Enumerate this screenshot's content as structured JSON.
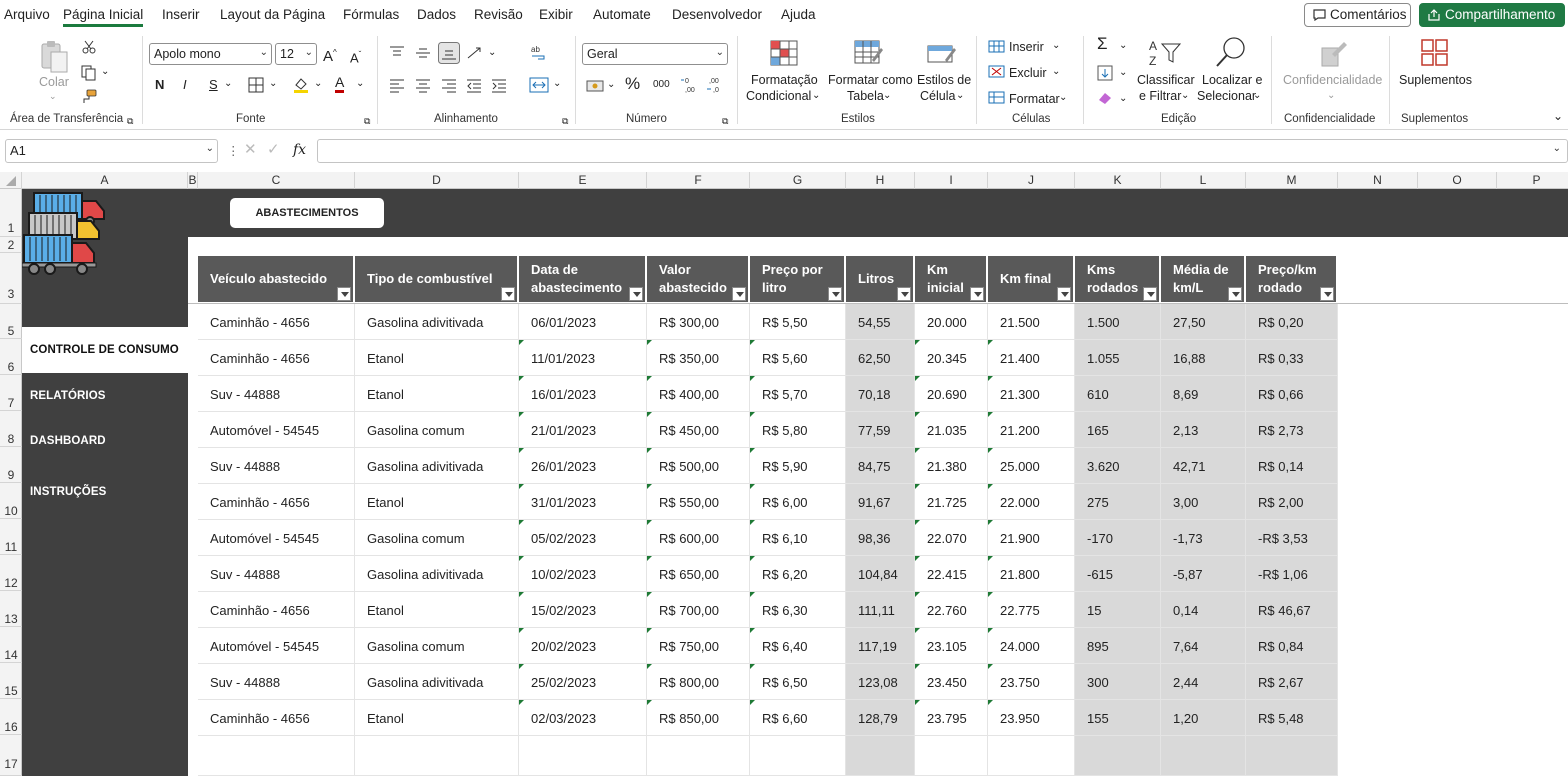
{
  "menu": {
    "items": [
      "Arquivo",
      "Página Inicial",
      "Inserir",
      "Layout da Página",
      "Fórmulas",
      "Dados",
      "Revisão",
      "Exibir",
      "Automate",
      "Desenvolvedor",
      "Ajuda"
    ],
    "comments_button": "Comentários",
    "share_button": "Compartilhamento"
  },
  "ribbon": {
    "clipboard": {
      "paste": "Colar",
      "label": "Área de Transferência"
    },
    "font": {
      "name": "Apolo mono",
      "size": "12",
      "bold": "N",
      "italic": "I",
      "underline": "S",
      "grow": "A",
      "shrink": "A",
      "color_letter": "A",
      "label": "Fonte"
    },
    "alignment": {
      "label": "Alinhamento"
    },
    "number": {
      "format": "Geral",
      "percent": "%",
      "thousands": "000",
      "label": "Número"
    },
    "styles": {
      "cond_format": [
        "Formatação",
        "Condicional"
      ],
      "format_table": [
        "Formatar como",
        "Tabela"
      ],
      "cell_styles": [
        "Estilos de",
        "Célula"
      ],
      "label": "Estilos"
    },
    "cells": {
      "insert": "Inserir",
      "delete": "Excluir",
      "format": "Formatar",
      "label": "Células"
    },
    "editing": {
      "sort": [
        "Classificar",
        "e Filtrar"
      ],
      "find": [
        "Localizar e",
        "Selecionar"
      ],
      "label": "Edição"
    },
    "sensitivity": {
      "button": "Confidencialidade",
      "label": "Confidencialidade"
    },
    "addins": {
      "button": "Suplementos",
      "label": "Suplementos"
    }
  },
  "formula_bar": {
    "name_box": "A1",
    "fx": "fx",
    "value": ""
  },
  "columns": [
    "A",
    "B",
    "C",
    "D",
    "E",
    "F",
    "G",
    "H",
    "I",
    "J",
    "K",
    "L",
    "M",
    "N",
    "O",
    "P"
  ],
  "rows": [
    "1",
    "2",
    "3",
    "5",
    "6",
    "7",
    "8",
    "9",
    "10",
    "11",
    "12",
    "13",
    "14",
    "15",
    "16",
    "17"
  ],
  "sidebar": {
    "items": [
      "CONTROLE DE CONSUMO",
      "RELATÓRIOS",
      "DASHBOARD",
      "INSTRUÇÕES"
    ]
  },
  "tab_button": "ABASTECIMENTOS",
  "table": {
    "headers": [
      [
        "Veículo abastecido"
      ],
      [
        "Tipo de combustível"
      ],
      [
        "Data de",
        "abastecimento"
      ],
      [
        "Valor",
        "abastecido"
      ],
      [
        "Preço por",
        "litro"
      ],
      [
        "Litros"
      ],
      [
        "Km",
        "inicial"
      ],
      [
        "Km final"
      ],
      [
        "Kms",
        "rodados"
      ],
      [
        "Média de",
        "km/L"
      ],
      [
        "Preço/km",
        "rodado"
      ]
    ],
    "rows": [
      [
        "Caminhão - 4656",
        "Gasolina adivitivada",
        "06/01/2023",
        "R$ 300,00",
        "R$ 5,50",
        "54,55",
        "20.000",
        "21.500",
        "1.500",
        "27,50",
        "R$ 0,20"
      ],
      [
        "Caminhão - 4656",
        "Etanol",
        "11/01/2023",
        "R$ 350,00",
        "R$ 5,60",
        "62,50",
        "20.345",
        "21.400",
        "1.055",
        "16,88",
        "R$ 0,33"
      ],
      [
        "Suv - 44888",
        "Etanol",
        "16/01/2023",
        "R$ 400,00",
        "R$ 5,70",
        "70,18",
        "20.690",
        "21.300",
        "610",
        "8,69",
        "R$ 0,66"
      ],
      [
        "Automóvel - 54545",
        "Gasolina comum",
        "21/01/2023",
        "R$ 450,00",
        "R$ 5,80",
        "77,59",
        "21.035",
        "21.200",
        "165",
        "2,13",
        "R$ 2,73"
      ],
      [
        "Suv - 44888",
        "Gasolina adivitivada",
        "26/01/2023",
        "R$ 500,00",
        "R$ 5,90",
        "84,75",
        "21.380",
        "25.000",
        "3.620",
        "42,71",
        "R$ 0,14"
      ],
      [
        "Caminhão - 4656",
        "Etanol",
        "31/01/2023",
        "R$ 550,00",
        "R$ 6,00",
        "91,67",
        "21.725",
        "22.000",
        "275",
        "3,00",
        "R$ 2,00"
      ],
      [
        "Automóvel - 54545",
        "Gasolina comum",
        "05/02/2023",
        "R$ 600,00",
        "R$ 6,10",
        "98,36",
        "22.070",
        "21.900",
        "-170",
        "-1,73",
        "-R$ 3,53"
      ],
      [
        "Suv - 44888",
        "Gasolina adivitivada",
        "10/02/2023",
        "R$ 650,00",
        "R$ 6,20",
        "104,84",
        "22.415",
        "21.800",
        "-615",
        "-5,87",
        "-R$ 1,06"
      ],
      [
        "Caminhão - 4656",
        "Etanol",
        "15/02/2023",
        "R$ 700,00",
        "R$ 6,30",
        "111,11",
        "22.760",
        "22.775",
        "15",
        "0,14",
        "R$ 46,67"
      ],
      [
        "Automóvel - 54545",
        "Gasolina comum",
        "20/02/2023",
        "R$ 750,00",
        "R$ 6,40",
        "117,19",
        "23.105",
        "24.000",
        "895",
        "7,64",
        "R$ 0,84"
      ],
      [
        "Suv - 44888",
        "Gasolina adivitivada",
        "25/02/2023",
        "R$ 800,00",
        "R$ 6,50",
        "123,08",
        "23.450",
        "23.750",
        "300",
        "2,44",
        "R$ 2,67"
      ],
      [
        "Caminhão - 4656",
        "Etanol",
        "02/03/2023",
        "R$ 850,00",
        "R$ 6,60",
        "128,79",
        "23.795",
        "23.950",
        "155",
        "1,20",
        "R$ 5,48"
      ]
    ]
  }
}
